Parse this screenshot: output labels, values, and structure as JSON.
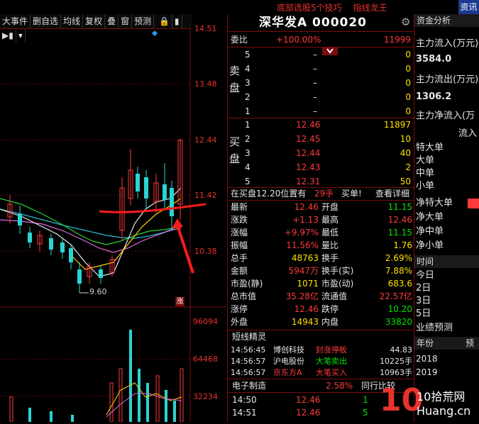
{
  "top_links": [
    "底部选股5个技巧",
    "指线龙王"
  ],
  "top_right_button": "资讯",
  "toolbar": [
    "大事件",
    "删自选",
    "均线",
    "复权",
    "叠",
    "窗",
    "预测"
  ],
  "chart_prices": [
    "14.51",
    "13.48",
    "12.44",
    "11.42",
    "10.38"
  ],
  "chart_low_label": "9.60",
  "chart_volumes": [
    "96094",
    "64468",
    "32234"
  ],
  "zhang_label": "涨",
  "stock_title": "深华发A  000020",
  "weibi": {
    "label": "委比",
    "pct": "+100.00%",
    "value": "11999"
  },
  "sell_label": [
    "卖",
    "盘"
  ],
  "sells": [
    {
      "lv": "5",
      "price": "–",
      "vol": "0"
    },
    {
      "lv": "4",
      "price": "–",
      "vol": "0"
    },
    {
      "lv": "3",
      "price": "–",
      "vol": "0"
    },
    {
      "lv": "2",
      "price": "–",
      "vol": "0"
    },
    {
      "lv": "1",
      "price": "–",
      "vol": "0"
    }
  ],
  "buy_label": [
    "买",
    "盘"
  ],
  "buys": [
    {
      "lv": "1",
      "price": "12.46",
      "vol": "11897"
    },
    {
      "lv": "2",
      "price": "12.45",
      "vol": "10"
    },
    {
      "lv": "3",
      "price": "12.44",
      "vol": "40"
    },
    {
      "lv": "4",
      "price": "12.43",
      "vol": "2"
    },
    {
      "lv": "5",
      "price": "12.31",
      "vol": "50"
    }
  ],
  "order_line": {
    "text": "在买盘12.20位置有",
    "count": "29手",
    "action": "买单!",
    "link": "查看详细"
  },
  "stats": [
    {
      "l1": "最新",
      "v1": "12.46",
      "l2": "开盘",
      "v2": "11.15"
    },
    {
      "l1": "涨跌",
      "v1": "+1.13",
      "l2": "最高",
      "v2": "12.46"
    },
    {
      "l1": "涨幅",
      "v1": "+9.97%",
      "l2": "最低",
      "v2": "11.15"
    },
    {
      "l1": "振幅",
      "v1": "11.56%",
      "l2": "量比",
      "v2": "1.76"
    },
    {
      "l1": "总手",
      "v1": "48763",
      "l2": "换手",
      "v2": "2.69%"
    },
    {
      "l1": "金额",
      "v1": "5947万",
      "l2": "换手(实)",
      "v2": "7.88%"
    },
    {
      "l1": "市盈(静)",
      "v1": "1071",
      "l2": "市盈(动)",
      "v2": "683.6"
    },
    {
      "l1": "总市值",
      "v1": "35.28亿",
      "l2": "流通值",
      "v2": "22.57亿"
    },
    {
      "l1": "涨停",
      "v1": "12.46",
      "l2": "跌停",
      "v2": "10.20"
    },
    {
      "l1": "外盘",
      "v1": "14943",
      "l2": "内盘",
      "v2": "33820"
    }
  ],
  "short_title": "短线精灵",
  "short_rows": [
    {
      "t": "14:56:45",
      "name": "博创科技",
      "evt": "封涨停板",
      "val": "44.83"
    },
    {
      "t": "14:56:57",
      "name": "沪电股份",
      "evt": "大笔卖出",
      "val": "10225手"
    },
    {
      "t": "14:56:57",
      "name": "京东方A",
      "evt": "大笔买入",
      "val": "10963手"
    }
  ],
  "sector": {
    "name": "电子制造",
    "pct": "2.58%",
    "tab": "同行比较"
  },
  "ticks": [
    {
      "t": "14:50",
      "p": "12.46",
      "v": "1"
    },
    {
      "t": "14:51",
      "p": "12.46",
      "v": "5"
    }
  ],
  "fund": {
    "title": "资金分析",
    "in_label": "主力流入(万元)",
    "in_val": "3584.0",
    "out_label": "主力流出(万元)",
    "out_val": "1306.2",
    "net_label": "主力净流入(万",
    "flow_label": "流入",
    "items": [
      "特大单",
      "大单",
      "中单",
      "小单"
    ],
    "net_items": [
      "净特大单",
      "净大单",
      "净中单",
      "净小单"
    ],
    "time_label": "时间",
    "days": [
      "今日",
      "2日",
      "3日",
      "5日"
    ],
    "forecast": "业绩预测",
    "year_label": "年份",
    "forecast_tab": "预",
    "years": [
      "2018",
      "2019"
    ]
  },
  "watermark": "10拾荒网 Huang.cn"
}
